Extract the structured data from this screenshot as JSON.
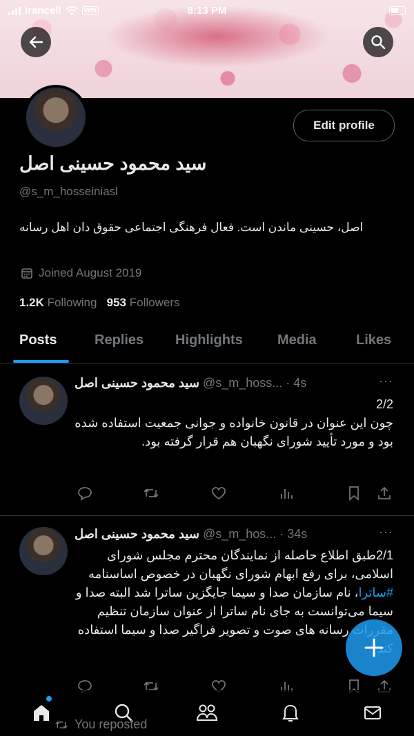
{
  "status_bar": {
    "carrier": "Irancell",
    "vpn": "VPN",
    "time": "8:13 PM"
  },
  "profile": {
    "name": "سید محمود حسینی اصل",
    "handle": "@s_m_hosseiniasl",
    "bio": "اصل، حسینی ماندن است. فعال فرهنگی اجتماعی حقوق دان اهل رسانه",
    "joined": "Joined August 2019",
    "following_count": "1.2K",
    "following_label": "Following",
    "followers_count": "953",
    "followers_label": "Followers",
    "edit_label": "Edit profile"
  },
  "tabs": [
    {
      "label": "Posts",
      "active": true
    },
    {
      "label": "Replies",
      "active": false
    },
    {
      "label": "Highlights",
      "active": false
    },
    {
      "label": "Media",
      "active": false
    },
    {
      "label": "Likes",
      "active": false
    }
  ],
  "tweets": [
    {
      "name": "سید محمود حسینی اصل",
      "handle": "@s_m_hoss...",
      "time": "· 4s",
      "more": "···",
      "line1": "2/2",
      "text": "چون این عنوان در قانون خانواده و جوانی جمعیت استفاده شده بود و مورد تأیید شورای نگهبان هم قرار گرفته بود."
    },
    {
      "name": "سید محمود حسینی اصل",
      "handle": "@s_m_hos...",
      "time": "· 34s",
      "more": "···",
      "text_a": "2/1طبق اطلاع حاصله از نمایندگان محترم مجلس شورای اسلامی، برای رفع ابهام شورای نگهبان در خصوص اساسنامه ",
      "hashtag": "#ساترا",
      "text_b": "، نام سازمان صدا و سیما جایگزین ساترا شد البته صدا و سیما می‌توانست به جای نام ساترا از عنوان سازمان تنظیم مقررات رسانه های صوت و تصویر فراگیر صدا و سیما استفاده کند"
    }
  ],
  "fab_icon": "plus-icon",
  "bottom_nav": [
    "home-icon",
    "search-icon",
    "communities-icon",
    "notifications-icon",
    "messages-icon"
  ],
  "reposted_label": "You reposted",
  "colors": {
    "accent": "#1d9bf0",
    "background": "#000000",
    "muted": "#71767b",
    "text": "#e7e9ea"
  }
}
